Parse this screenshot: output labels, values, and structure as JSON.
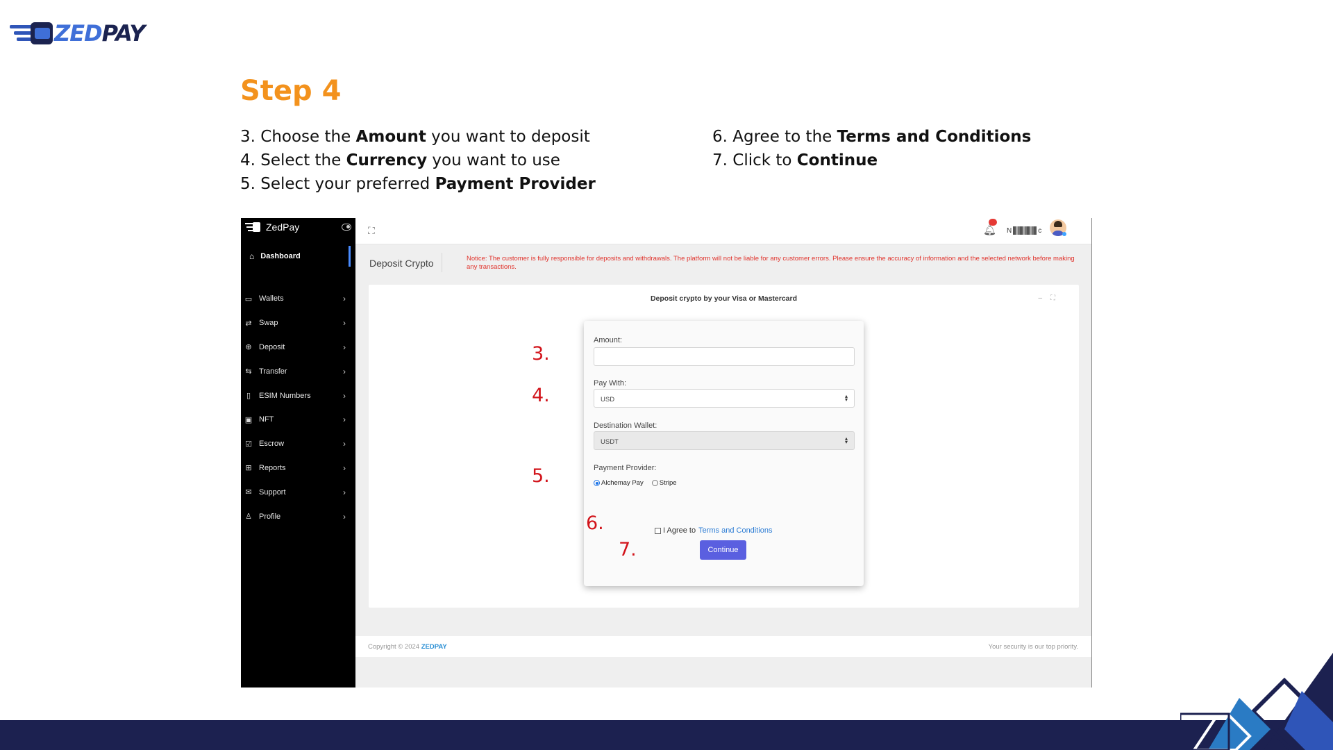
{
  "brand": {
    "zed": "ZED",
    "pay": "PAY"
  },
  "step": {
    "title": "Step 4"
  },
  "instructions": {
    "left": [
      {
        "prefix": "3. Choose the ",
        "bold": "Amount",
        "suffix": " you want to deposit"
      },
      {
        "prefix": "4. Select the ",
        "bold": "Currency",
        "suffix": " you want to use"
      },
      {
        "prefix": "5. Select your preferred ",
        "bold": "Payment Provider",
        "suffix": ""
      }
    ],
    "right": [
      {
        "prefix": "6. Agree to the ",
        "bold": "Terms and Conditions",
        "suffix": ""
      },
      {
        "prefix": "7. Click to ",
        "bold": "Continue",
        "suffix": ""
      }
    ]
  },
  "app": {
    "name": "ZedPay",
    "dashboard": "Dashboard",
    "menu": [
      {
        "label": "Wallets",
        "icon": "wallet-icon"
      },
      {
        "label": "Swap",
        "icon": "swap-icon"
      },
      {
        "label": "Deposit",
        "icon": "plus-circle-icon"
      },
      {
        "label": "Transfer",
        "icon": "transfer-icon"
      },
      {
        "label": "ESIM Numbers",
        "icon": "phone-icon"
      },
      {
        "label": "NFT",
        "icon": "image-icon"
      },
      {
        "label": "Escrow",
        "icon": "check-square-icon"
      },
      {
        "label": "Reports",
        "icon": "grid-icon"
      },
      {
        "label": "Support",
        "icon": "mail-icon"
      },
      {
        "label": "Profile",
        "icon": "user-icon"
      }
    ],
    "user": {
      "start": "N",
      "end": "c"
    },
    "page_title": "Deposit Crypto",
    "notice": "Notice: The customer is fully responsible for deposits and withdrawals. The platform will not be liable for any customer errors. Please ensure the accuracy of information and the selected network before making any transactions.",
    "card_title": "Deposit crypto by your Visa or Mastercard",
    "form": {
      "amount_label": "Amount:",
      "amount_value": "",
      "pay_with_label": "Pay With:",
      "pay_with_value": "USD",
      "dest_label": "Destination Wallet:",
      "dest_value": "USDT",
      "provider_label": "Payment Provider:",
      "provider_options": [
        "Alchemay Pay",
        "Stripe"
      ],
      "provider_selected": "Alchemay Pay",
      "agree_text": "I Agree to",
      "terms_link": "Terms and Conditions",
      "continue_label": "Continue"
    },
    "markers": [
      "3.",
      "4.",
      "5.",
      "6.",
      "7."
    ],
    "footer": {
      "copyright": "Copyright © 2024",
      "brand": "ZEDPAY",
      "security": "Your security is our top priority."
    }
  },
  "colors": {
    "accent_orange": "#f3921d",
    "navy": "#1c2150",
    "button": "#5a5fe0",
    "marker_red": "#d2141b"
  }
}
